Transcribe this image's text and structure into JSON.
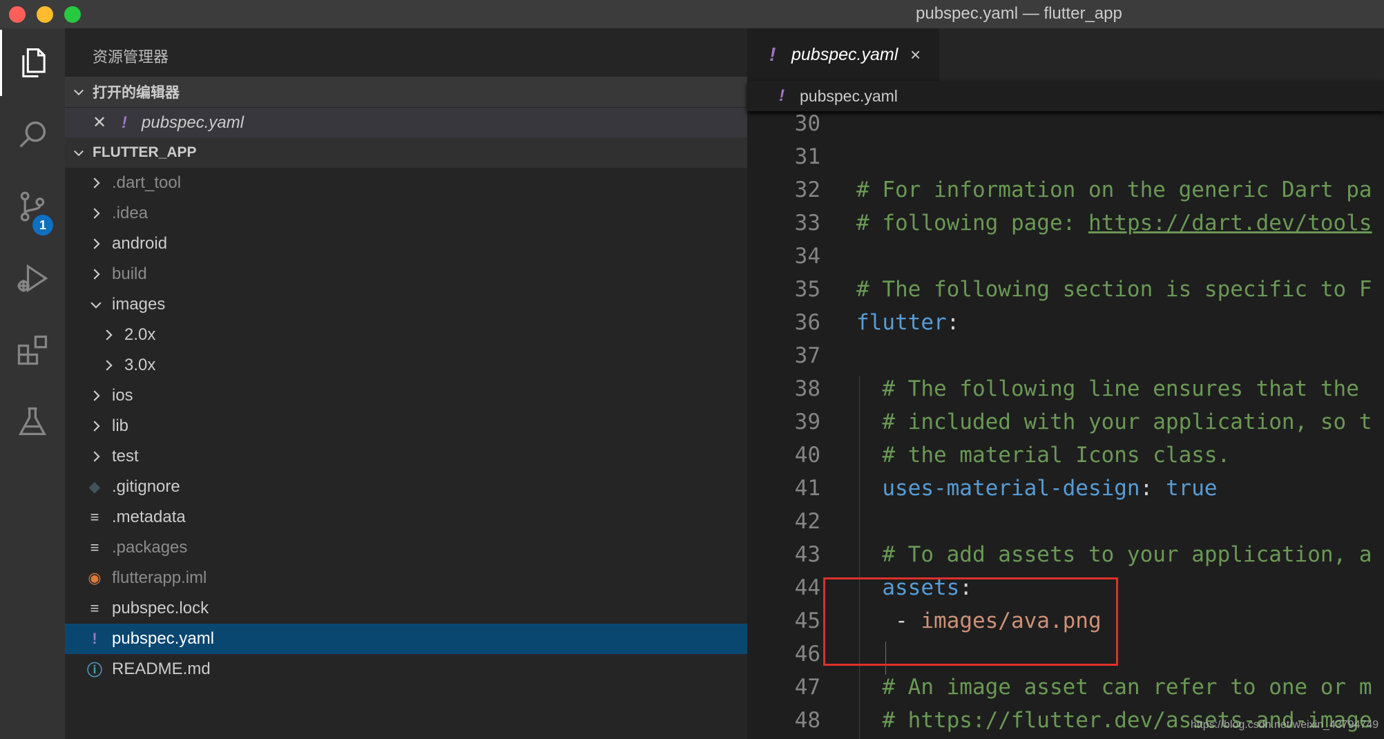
{
  "window": {
    "title": "pubspec.yaml — flutter_app"
  },
  "activity_bar": {
    "items": [
      {
        "name": "explorer",
        "icon": "files-icon",
        "active": true
      },
      {
        "name": "search",
        "icon": "search-icon"
      },
      {
        "name": "source-control",
        "icon": "source-control-icon",
        "badge": "1"
      },
      {
        "name": "run-debug",
        "icon": "run-debug-icon"
      },
      {
        "name": "extensions",
        "icon": "extensions-icon"
      },
      {
        "name": "testing",
        "icon": "flask-icon"
      }
    ]
  },
  "sidebar": {
    "title": "资源管理器",
    "open_editors": {
      "header": "打开的编辑器",
      "items": [
        {
          "label": "pubspec.yaml",
          "icon": "yaml-icon"
        }
      ]
    },
    "project": {
      "header": "FLUTTER_APP",
      "items": [
        {
          "label": ".dart_tool",
          "type": "folder",
          "expanded": false,
          "dim": true
        },
        {
          "label": ".idea",
          "type": "folder",
          "expanded": false,
          "dim": true
        },
        {
          "label": "android",
          "type": "folder",
          "expanded": false
        },
        {
          "label": "build",
          "type": "folder",
          "expanded": false,
          "dim": true
        },
        {
          "label": "images",
          "type": "folder",
          "expanded": true
        },
        {
          "label": "2.0x",
          "type": "folder",
          "expanded": false,
          "indent": 1
        },
        {
          "label": "3.0x",
          "type": "folder",
          "expanded": false,
          "indent": 1
        },
        {
          "label": "ios",
          "type": "folder",
          "expanded": false
        },
        {
          "label": "lib",
          "type": "folder",
          "expanded": false
        },
        {
          "label": "test",
          "type": "folder",
          "expanded": false
        },
        {
          "label": ".gitignore",
          "type": "file",
          "icon": "git-icon"
        },
        {
          "label": ".metadata",
          "type": "file",
          "icon": "lines-icon"
        },
        {
          "label": ".packages",
          "type": "file",
          "icon": "lines-icon",
          "dim": true
        },
        {
          "label": "flutterapp.iml",
          "type": "file",
          "icon": "rss-icon",
          "dim": true
        },
        {
          "label": "pubspec.lock",
          "type": "file",
          "icon": "lines-icon"
        },
        {
          "label": "pubspec.yaml",
          "type": "file",
          "icon": "yaml-icon",
          "selected": true
        },
        {
          "label": "README.md",
          "type": "file",
          "icon": "info-icon"
        }
      ]
    }
  },
  "editor": {
    "tab": {
      "label": "pubspec.yaml",
      "close": "×"
    },
    "breadcrumb": "pubspec.yaml",
    "lines": [
      {
        "num": "30",
        "parts": []
      },
      {
        "num": "31",
        "parts": []
      },
      {
        "num": "32",
        "parts": [
          {
            "t": "# For information on the generic Dart pa",
            "c": "comment"
          }
        ]
      },
      {
        "num": "33",
        "parts": [
          {
            "t": "# following page: ",
            "c": "comment"
          },
          {
            "t": "https://dart.dev/tools",
            "c": "link"
          }
        ]
      },
      {
        "num": "34",
        "parts": []
      },
      {
        "num": "35",
        "parts": [
          {
            "t": "# The following section is specific to F",
            "c": "comment"
          }
        ]
      },
      {
        "num": "36",
        "parts": [
          {
            "t": "flutter",
            "c": "key"
          },
          {
            "t": ":",
            "c": "punct"
          }
        ]
      },
      {
        "num": "37",
        "parts": []
      },
      {
        "num": "38",
        "parts": [
          {
            "t": "  # The following line ensures that the",
            "c": "comment"
          }
        ]
      },
      {
        "num": "39",
        "parts": [
          {
            "t": "  # included with your application, so t",
            "c": "comment"
          }
        ]
      },
      {
        "num": "40",
        "parts": [
          {
            "t": "  # the material Icons class.",
            "c": "comment"
          }
        ]
      },
      {
        "num": "41",
        "parts": [
          {
            "t": "  uses-material-design",
            "c": "key"
          },
          {
            "t": ": ",
            "c": "punct"
          },
          {
            "t": "true",
            "c": "key"
          }
        ]
      },
      {
        "num": "42",
        "parts": []
      },
      {
        "num": "43",
        "parts": [
          {
            "t": "  # To add assets to your application, a",
            "c": "comment"
          }
        ]
      },
      {
        "num": "44",
        "parts": [
          {
            "t": "  assets",
            "c": "key"
          },
          {
            "t": ":",
            "c": "punct"
          }
        ]
      },
      {
        "num": "45",
        "parts": [
          {
            "t": "   - ",
            "c": "punct"
          },
          {
            "t": "images/ava.png",
            "c": "str"
          }
        ]
      },
      {
        "num": "46",
        "parts": []
      },
      {
        "num": "47",
        "parts": [
          {
            "t": "  # An image asset can refer to one or m",
            "c": "comment"
          }
        ]
      },
      {
        "num": "48",
        "parts": [
          {
            "t": "  # https://flutter.dev/assets-and-image",
            "c": "comment"
          }
        ]
      }
    ]
  },
  "watermark": "https://blog.csdn.net/weixin_43794749",
  "colors": {
    "accent": "#0e70c0",
    "selection": "#094771",
    "highlight_box": "#e0302a",
    "yaml_icon": "#a074c4"
  }
}
